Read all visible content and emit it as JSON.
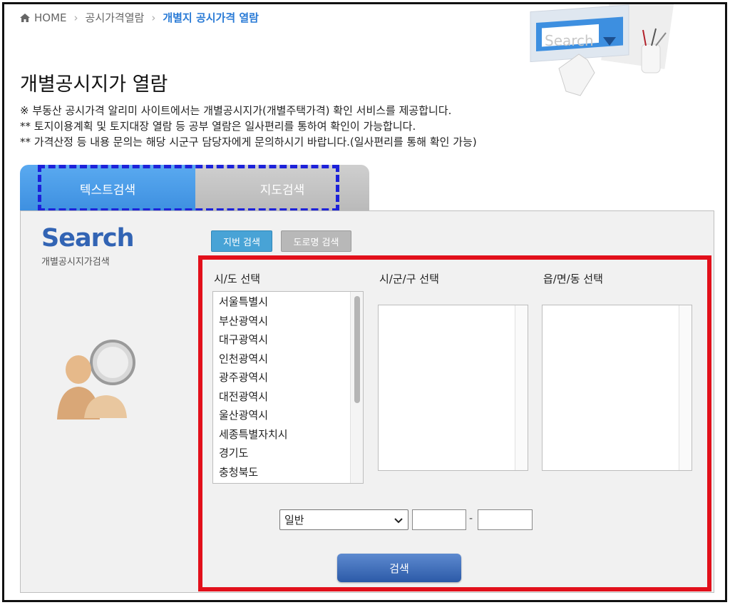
{
  "breadcrumb": {
    "home": "HOME",
    "level1": "공시가격열람",
    "current": "개별지 공시가격 열람"
  },
  "hero": {
    "search_text": "Search"
  },
  "page_title": "개별공시지가 열람",
  "notes": [
    "※ 부동산 공시가격 알리미 사이트에서는 개별공시지가(개별주택가격) 확인 서비스를 제공합니다.",
    "** 토지이용계획 및 토지대장 열람 등 공부 열람은 일사편리를 통하여 확인이 가능합니다.",
    "** 가격산정 등 내용 문의는 해당 시군구 담당자에게 문의하시기 바랍니다.(일사편리를 통해 확인 가능)"
  ],
  "tabs": {
    "text_search": "텍스트검색",
    "map_search": "지도검색"
  },
  "sidebar": {
    "logo": "Search",
    "subtitle": "개별공시지가검색"
  },
  "subtabs": {
    "lot": "지번 검색",
    "road": "도로명 검색"
  },
  "columns": {
    "sido": "시/도 선택",
    "sigungu": "시/군/구 선택",
    "eupmyeondong": "읍/면/동 선택"
  },
  "sido_items": [
    "서울특별시",
    "부산광역시",
    "대구광역시",
    "인천광역시",
    "광주광역시",
    "대전광역시",
    "울산광역시",
    "세종특별자치시",
    "경기도",
    "충청북도"
  ],
  "form": {
    "type_selected": "일반",
    "separator": "-"
  },
  "search_button": "검색",
  "colors": {
    "accent_blue": "#3d8fe0",
    "highlight_red": "#e2101b",
    "dash_blue": "#1d22d9",
    "current_crumb": "#2a7bd6"
  }
}
